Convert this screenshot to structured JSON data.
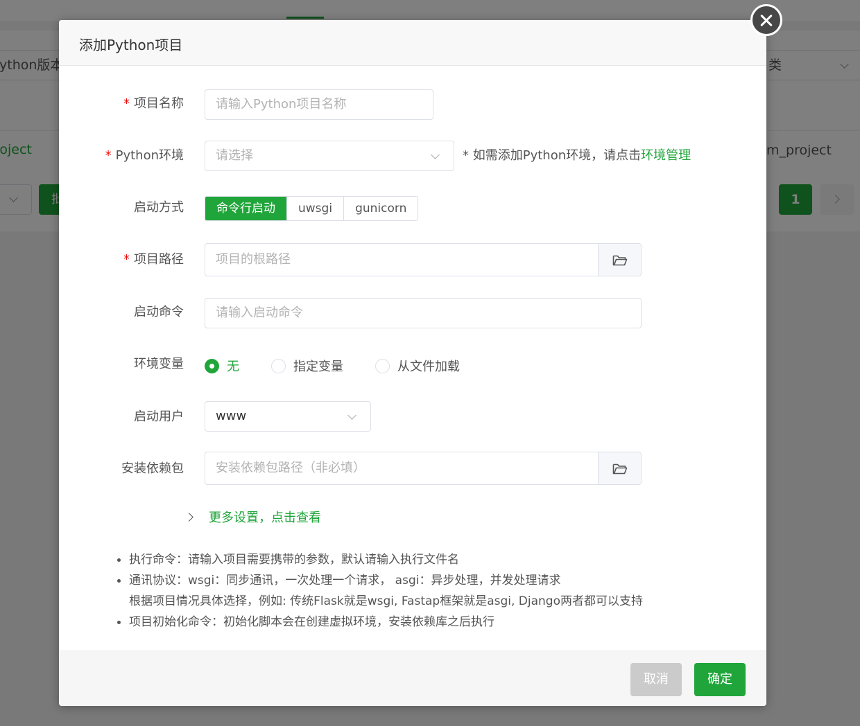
{
  "background": {
    "select_left": "ython版本管",
    "select_right": "类",
    "row_left": "roject",
    "row_right": "m_project",
    "button_left": "批",
    "page_current": "1"
  },
  "dialog": {
    "title": "添加Python项目",
    "required_mark": "*",
    "fields": {
      "name": {
        "label": "项目名称",
        "placeholder": "请输入Python项目名称"
      },
      "env": {
        "label": "Python环境",
        "placeholder": "请选择",
        "hint_prefix": "* 如需添加Python环境，请点击",
        "hint_link": "环境管理"
      },
      "start_mode": {
        "label": "启动方式",
        "options": [
          "命令行启动",
          "uwsgi",
          "gunicorn"
        ],
        "selected": "命令行启动"
      },
      "path": {
        "label": "项目路径",
        "placeholder": "项目的根路径"
      },
      "command": {
        "label": "启动命令",
        "placeholder": "请输入启动命令"
      },
      "env_vars": {
        "label": "环境变量",
        "options": [
          "无",
          "指定变量",
          "从文件加载"
        ],
        "selected": "无"
      },
      "user": {
        "label": "启动用户",
        "value": "www"
      },
      "deps": {
        "label": "安装依赖包",
        "placeholder": "安装依赖包路径（非必填）"
      }
    },
    "more_settings": "更多设置，点击查看",
    "notes": [
      "执行命令：请输入项目需要携带的参数，默认请输入执行文件名",
      "通讯协议：wsgi：同步通讯，一次处理一个请求，  asgi：异步处理，并发处理请求",
      "根据项目情况具体选择，例如: 传统Flask就是wsgi, Fastap框架就是asgi, Django两者都可以支持",
      "项目初始化命令：初始化脚本会在创建虚拟环境，安装依赖库之后执行"
    ],
    "buttons": {
      "cancel": "取消",
      "confirm": "确定"
    }
  },
  "colors": {
    "accent": "#20a53a",
    "required": "#ef0808",
    "overlay": "rgba(0,0,0,0.5)"
  },
  "icons": {
    "close": "close-icon",
    "folder": "folder-icon",
    "chevron": "chevron-down-icon"
  }
}
